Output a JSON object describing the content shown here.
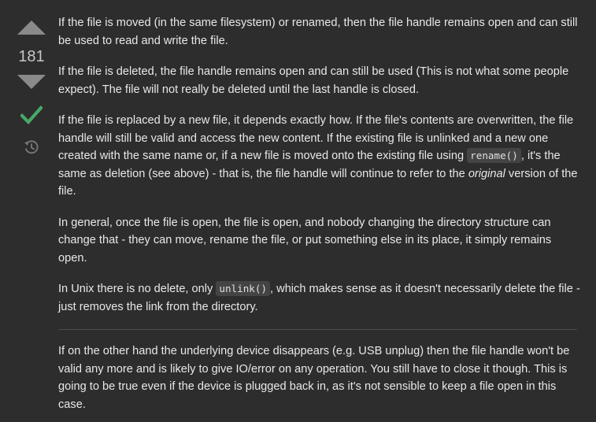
{
  "vote": {
    "score": "181",
    "icons": {
      "up": "caret-up-icon",
      "down": "caret-down-icon",
      "accepted": "checkmark-icon",
      "history": "history-icon"
    },
    "colors": {
      "arrow": "#8a8a8a",
      "accepted": "#48a868"
    }
  },
  "answer": {
    "p1": "If the file is moved (in the same filesystem) or renamed, then the file handle remains open and can still be used to read and write the file.",
    "p2": "If the file is deleted, the file handle remains open and can still be used (This is not what some people expect). The file will not really be deleted until the last handle is closed.",
    "p3": {
      "text_a": "If the file is replaced by a new file, it depends exactly how. If the file's contents are overwritten, the file handle will still be valid and access the new content. If the existing file is unlinked and a new one created with the same name or, if a new file is moved onto the existing file using ",
      "code": "rename()",
      "text_b": ", it's the same as deletion (see above) - that is, the file handle will continue to refer to the ",
      "emphasis": "original",
      "text_c": " version of the file."
    },
    "p4": "In general, once the file is open, the file is open, and nobody changing the directory structure can change that - they can move, rename the file, or put something else in its place, it simply remains open.",
    "p5": {
      "text_a": "In Unix there is no delete, only ",
      "code": "unlink()",
      "text_b": ", which makes sense as it doesn't necessarily delete the file - just removes the link from the directory."
    },
    "p6": "If on the other hand the underlying device disappears (e.g. USB unplug) then the file handle won't be valid any more and is likely to give IO/error on any operation. You still have to close it though. This is going to be true even if the device is plugged back in, as it's not sensible to keep a file open in this case."
  }
}
